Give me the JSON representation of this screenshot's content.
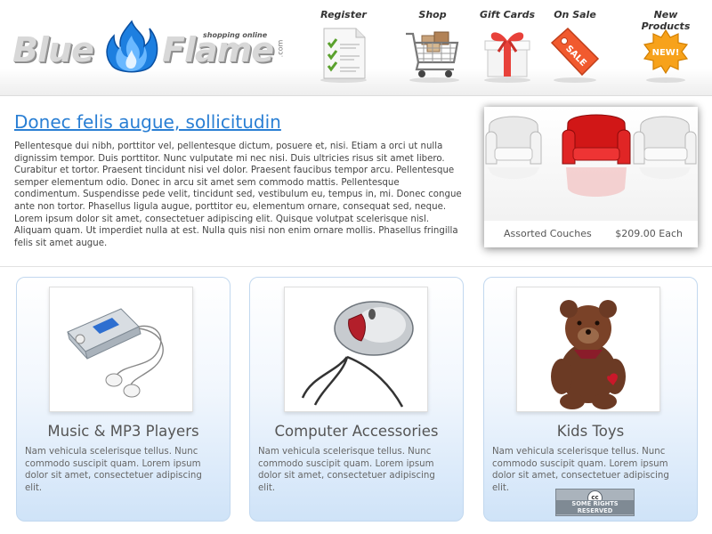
{
  "logo": {
    "word1": "Blue",
    "word2": "Flame",
    "dot_com": ".com",
    "tagline": "shopping online",
    "flame_color": "#1d7fe0"
  },
  "nav": {
    "items": [
      {
        "label": "Register",
        "icon": "checklist-icon"
      },
      {
        "label": "Shop",
        "icon": "shopping-cart-icon"
      },
      {
        "label": "Gift Cards",
        "icon": "gift-box-icon"
      },
      {
        "label": "On Sale",
        "icon": "sale-tag-icon",
        "tag_text": "SALE"
      },
      {
        "label": "New Products",
        "icon": "new-starburst-icon",
        "badge_text": "NEW!"
      }
    ]
  },
  "feature": {
    "title": "Donec felis augue, sollicitudin",
    "body": "Pellentesque dui nibh, porttitor vel, pellentesque dictum, posuere et, nisi. Etiam a orci ut nulla dignissim tempor. Duis porttitor. Nunc vulputate mi nec nisi. Duis ultricies risus sit amet libero. Curabitur et tortor. Praesent tincidunt nisi vel dolor. Praesent faucibus tempor arcu. Pellentesque semper elementum odio. Donec in arcu sit amet sem commodo mattis. Pellentesque condimentum. Suspendisse pede velit, tincidunt sed, vestibulum eu, tempus in, mi. Donec congue ante non tortor. Phasellus ligula augue, porttitor eu, elementum ornare, consequat sed, neque. Lorem ipsum dolor sit amet, consectetuer adipiscing elit. Quisque volutpat scelerisque nisl. Aliquam quam. Ut imperdiet nulla at est. Nulla quis nisi non enim ornare mollis. Phasellus fringilla felis sit amet augue."
  },
  "featured_product": {
    "name": "Assorted Couches",
    "price": "$209.00 Each",
    "icon": "armchairs-photo"
  },
  "categories": [
    {
      "title": "Music & MP3 Players",
      "description": "Nam vehicula scelerisque tellus. Nunc commodo suscipit quam. Lorem ipsum dolor sit amet, consectetuer adipiscing elit.",
      "icon": "mp3-player-photo"
    },
    {
      "title": "Computer Accessories",
      "description": "Nam vehicula scelerisque tellus. Nunc commodo suscipit quam. Lorem ipsum dolor sit amet, consectetuer adipiscing elit.",
      "icon": "computer-mouse-photo"
    },
    {
      "title": "Kids Toys",
      "description": "Nam vehicula scelerisque tellus. Nunc commodo suscipit quam. Lorem ipsum dolor sit amet, consectetuer adipiscing elit.",
      "icon": "teddy-bear-photo"
    }
  ],
  "license_badge": {
    "symbol": "cc",
    "text": "SOME RIGHTS RESERVED"
  },
  "colors": {
    "link_blue": "#2a7fd4",
    "category_gradient_bottom": "#cfe3f8",
    "category_border": "#c2d8ef",
    "gift_ribbon": "#e8413a",
    "sale_tag": "#f15a2e",
    "new_badge": "#f7a21b"
  }
}
